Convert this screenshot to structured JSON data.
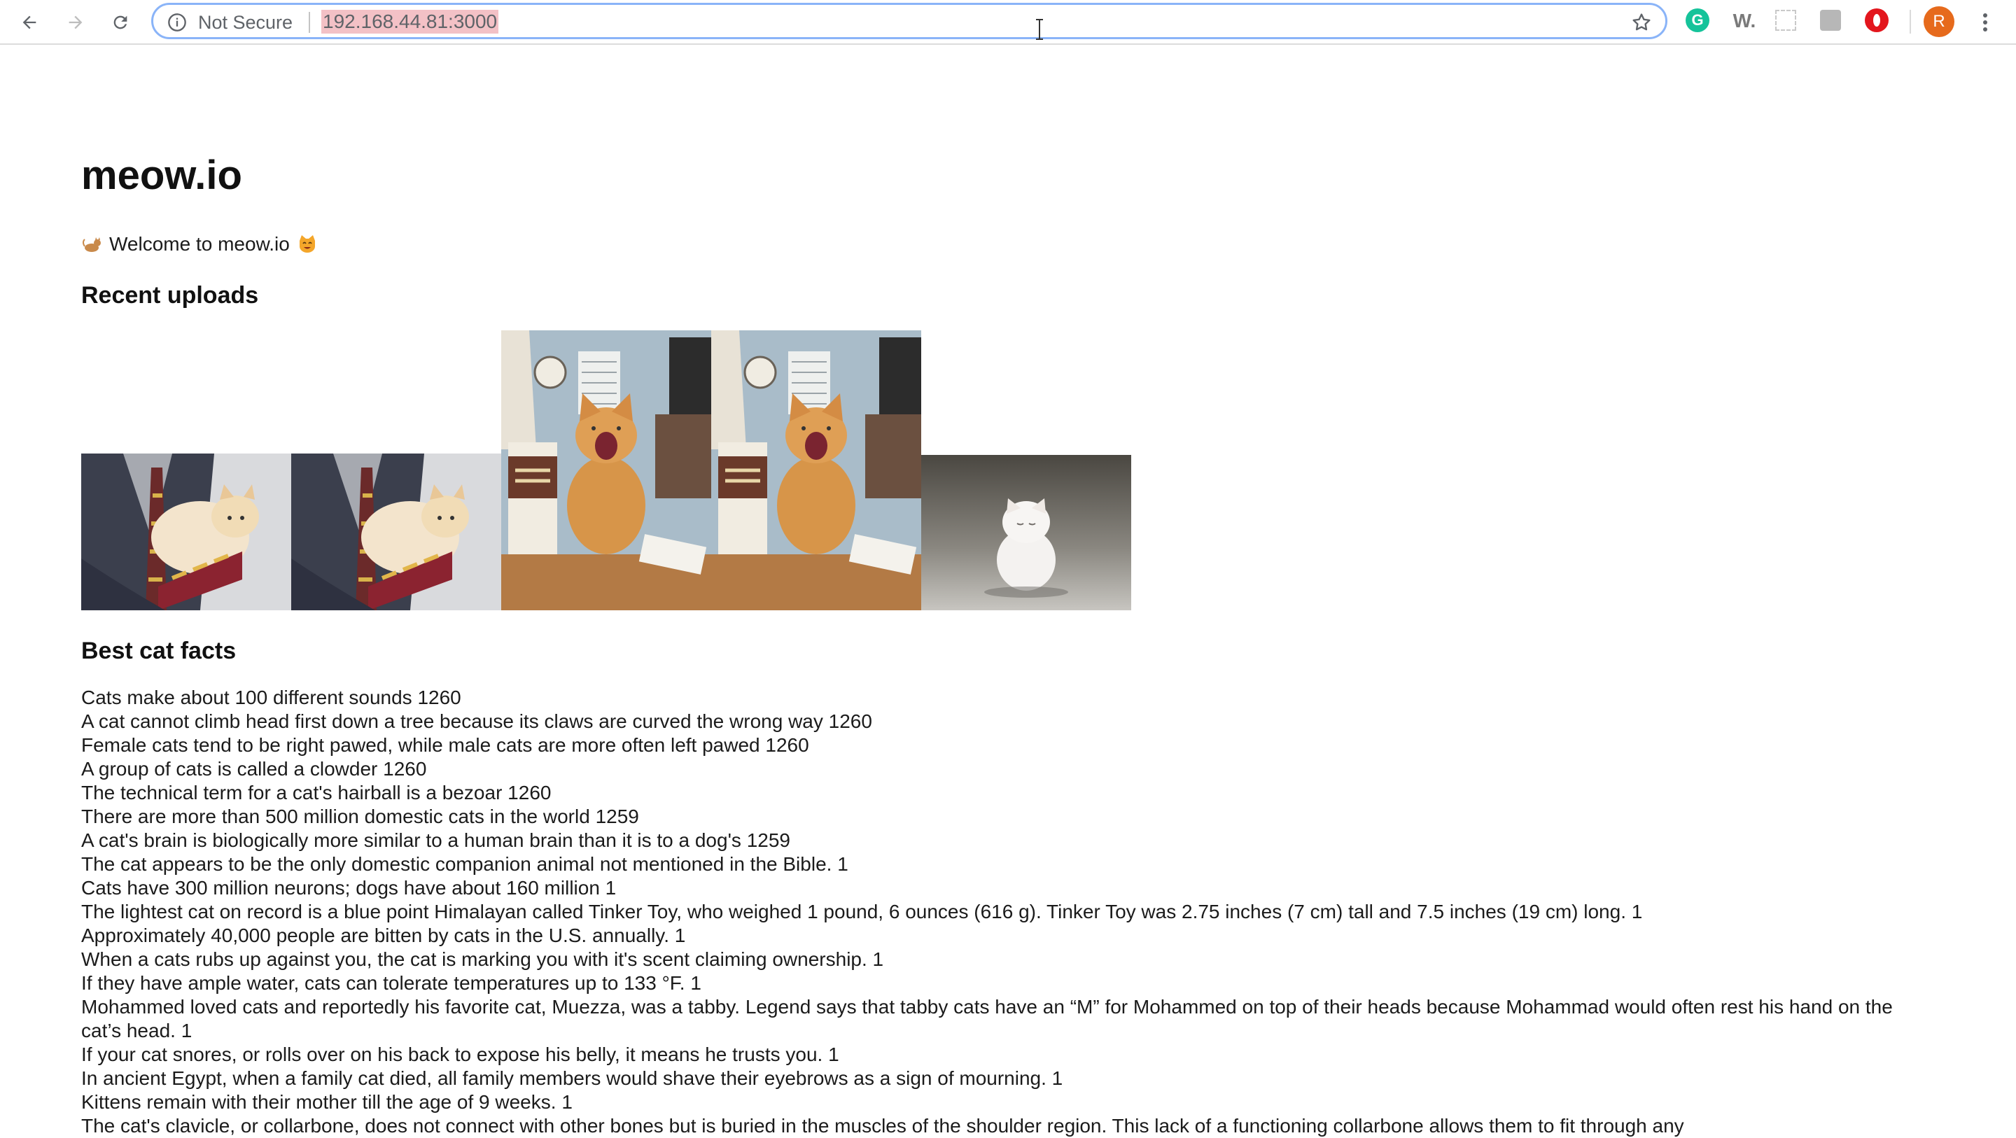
{
  "browser": {
    "security_label": "Not Secure",
    "url": "192.168.44.81:3000",
    "profile_initial": "R",
    "extensions": [
      {
        "name": "grammarly",
        "label": "G"
      },
      {
        "name": "wikiwand",
        "label": "W."
      }
    ]
  },
  "page": {
    "title": "meow.io",
    "welcome": "Welcome to meow.io",
    "recent_heading": "Recent uploads",
    "facts_heading": "Best cat facts",
    "uploads": [
      {
        "subject": "orange cat held in arms"
      },
      {
        "subject": "orange cat held in arms"
      },
      {
        "subject": "orange cat yawning on desk"
      },
      {
        "subject": "orange cat yawning on desk"
      },
      {
        "subject": "white fluffy kitten"
      }
    ],
    "facts": [
      "Cats make about 100 different sounds 1260",
      "A cat cannot climb head first down a tree because its claws are curved the wrong way 1260",
      "Female cats tend to be right pawed, while male cats are more often left pawed 1260",
      "A group of cats is called a clowder 1260",
      "The technical term for a cat's hairball is a bezoar 1260",
      "There are more than 500 million domestic cats in the world 1259",
      "A cat's brain is biologically more similar to a human brain than it is to a dog's 1259",
      "The cat appears to be the only domestic companion animal not mentioned in the Bible. 1",
      "Cats have 300 million neurons; dogs have about 160 million 1",
      "The lightest cat on record is a blue point Himalayan called Tinker Toy, who weighed 1 pound, 6 ounces (616 g). Tinker Toy was 2.75 inches (7 cm) tall and 7.5 inches (19 cm) long. 1",
      "Approximately 40,000 people are bitten by cats in the U.S. annually. 1",
      "When a cats rubs up against you, the cat is marking you with it's scent claiming ownership. 1",
      "If they have ample water, cats can tolerate temperatures up to 133 °F. 1",
      "Mohammed loved cats and reportedly his favorite cat, Muezza, was a tabby. Legend says that tabby cats have an “M” for Mohammed on top of their heads because Mohammad would often rest his hand on the cat’s head. 1",
      "If your cat snores, or rolls over on his back to expose his belly, it means he trusts you. 1",
      "In ancient Egypt, when a family cat died, all family members would shave their eyebrows as a sign of mourning. 1",
      "Kittens remain with their mother till the age of 9 weeks. 1",
      "The cat's clavicle, or collarbone, does not connect with other bones but is buried in the muscles of the shoulder region. This lack of a functioning collarbone allows them to fit through any"
    ]
  },
  "colors": {
    "url_highlight": "#f3c1c6",
    "omnibox_focus": "#8ab4f8",
    "avatar": "#e66a1c",
    "grammarly": "#15c39a",
    "opera": "#e3161d"
  }
}
